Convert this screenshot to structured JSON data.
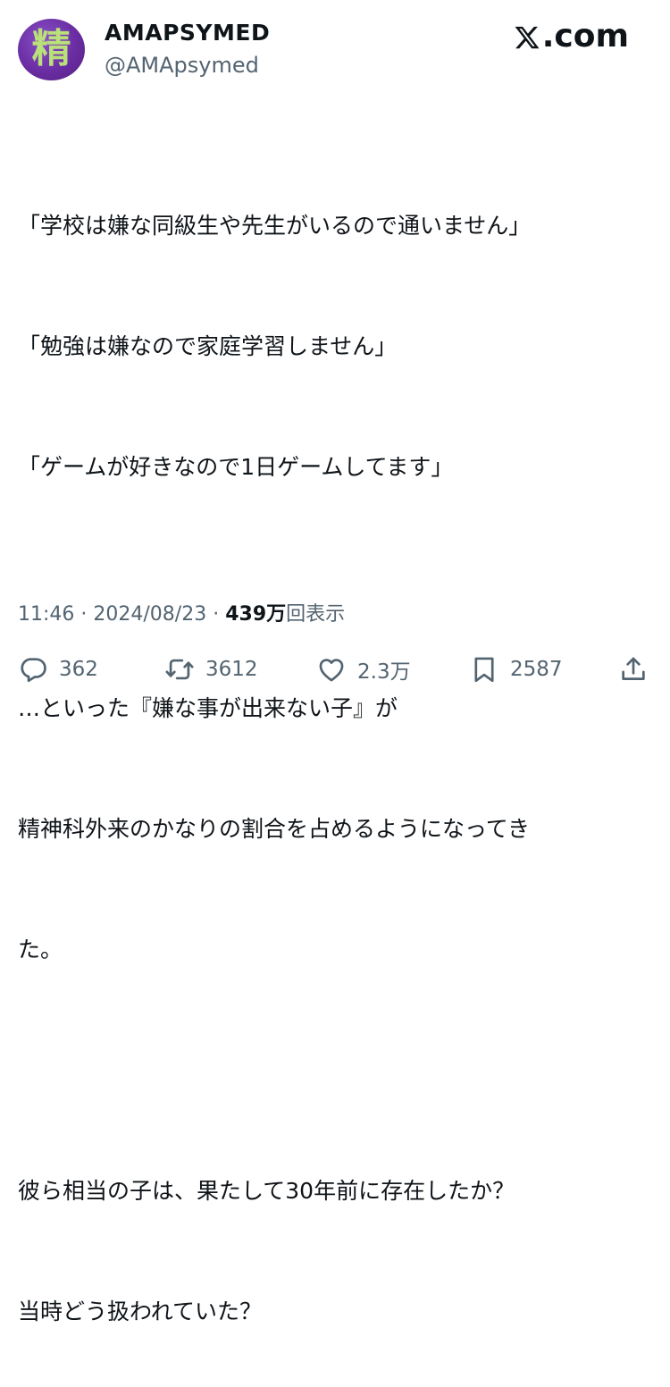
{
  "author": {
    "avatar_glyph": "精",
    "display_name": "AMAPSYMED",
    "handle": "@AMApsymed"
  },
  "brand": {
    "label": ".com"
  },
  "tweet": {
    "lines": [
      "「学校は嫌な同級生や先生がいるので通いません」",
      "「勉強は嫌なので家庭学習しません」",
      "「ゲームが好きなので1日ゲームしてます」",
      "",
      "…といった『嫌な事が出来ない子』が",
      "精神科外来のかなりの割合を占めるようになってき",
      "た。",
      "",
      "彼ら相当の子は、果たして30年前に存在したか？",
      "当時どう扱われていた？"
    ]
  },
  "meta": {
    "time": "11:46",
    "date": "2024/08/23",
    "separator": "·",
    "views_number": "439",
    "views_unit": "万",
    "views_label": "回表示"
  },
  "actions": {
    "replies": "362",
    "reposts": "3612",
    "likes": "2.3万",
    "bookmarks": "2587"
  },
  "icons": {
    "reply": "speech-bubble-icon",
    "repost": "repost-arrows-icon",
    "like": "heart-icon",
    "bookmark": "bookmark-icon",
    "share": "share-upload-icon",
    "brand": "x-logo-icon"
  },
  "colors": {
    "text": "#0f1419",
    "secondary": "#536471",
    "avatar_bg": "#6a2da3",
    "avatar_glyph": "#b9e07a"
  }
}
